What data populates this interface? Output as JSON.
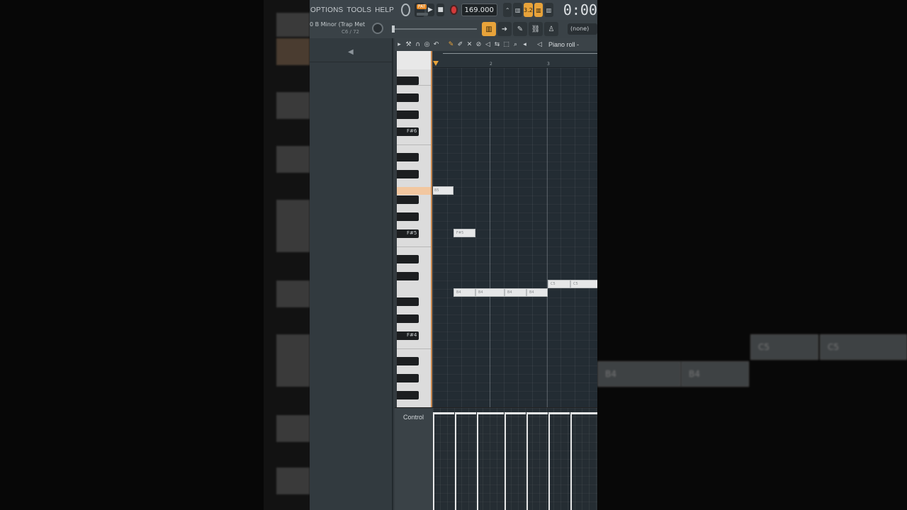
{
  "menu": [
    "OPTIONS",
    "TOOLS",
    "HELP"
  ],
  "transport": {
    "pat_label": "PAT",
    "play_icon": "play-icon",
    "stop_icon": "stop-icon",
    "tempo": "169.000",
    "time": "0:00"
  },
  "toolbar_icons": [
    "metronome-icon",
    "wait-icon",
    "countdown-icon",
    "step-icon",
    "loop-record-icon"
  ],
  "preset": {
    "name": "0 B Minor (Trap Met",
    "sub": "C6 / 72"
  },
  "selector": {
    "value": "(none)"
  },
  "piano_roll": {
    "title": "Piano roll -",
    "ruler_numbers": [
      "2",
      "3"
    ]
  },
  "keyboard": {
    "labels": [
      "F#6",
      "F#5",
      "F#4"
    ]
  },
  "notes": [
    {
      "label": "B5"
    },
    {
      "label": "F#5"
    },
    {
      "label": "B4"
    },
    {
      "label": "B4"
    },
    {
      "label": "B4"
    },
    {
      "label": "B4"
    },
    {
      "label": "C5"
    },
    {
      "label": "C5"
    }
  ],
  "control": {
    "label": "Control"
  },
  "background_notes": [
    "C5",
    "C5",
    "B4",
    "B4"
  ],
  "colors": {
    "accent": "#e8a33a",
    "record": "#d43a3a",
    "note": "#e6e7e8",
    "grid": "#232c33"
  }
}
